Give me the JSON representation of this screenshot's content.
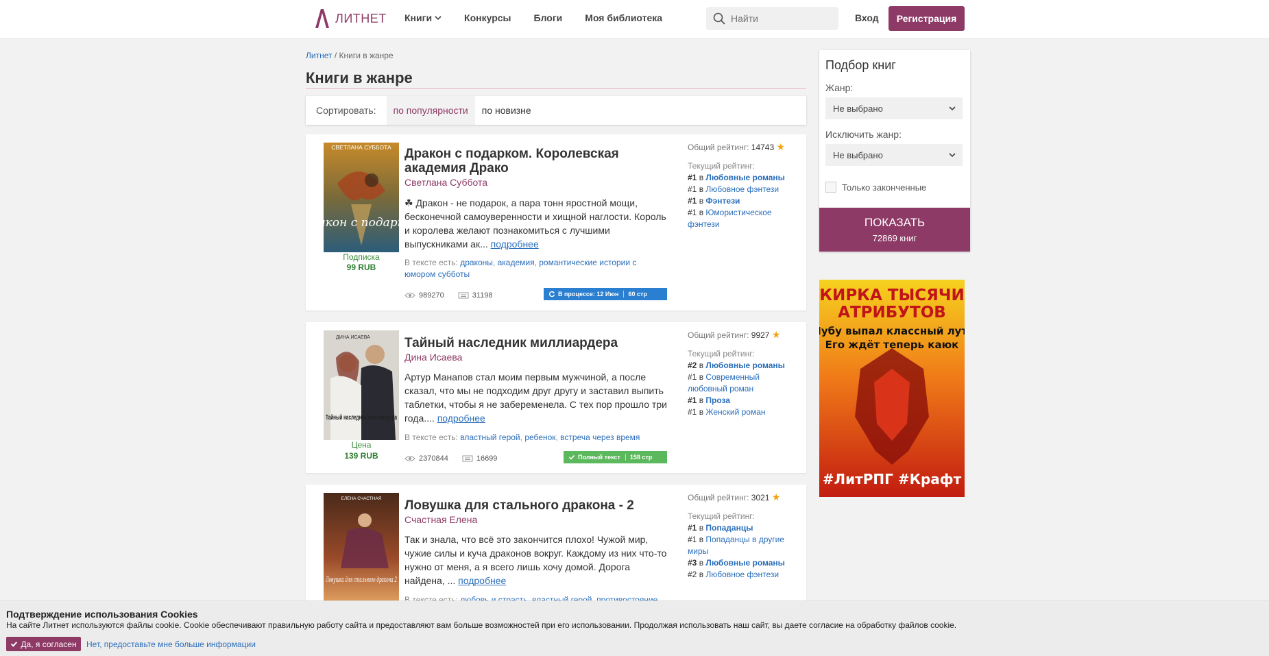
{
  "header": {
    "logo_text": "ЛИТНЕТ",
    "nav": [
      "Книги",
      "Конкурсы",
      "Блоги",
      "Моя библиотека"
    ],
    "search_placeholder": "Найти",
    "login": "Вход",
    "register": "Регистрация"
  },
  "breadcrumb": {
    "home": "Литнет",
    "sep": " / ",
    "current": "Книги в жанре"
  },
  "page_title": "Книги в жанре",
  "sort": {
    "label": "Сортировать:",
    "active": "по популярности",
    "other": "по новизне"
  },
  "books": [
    {
      "title": "Дракон с подарком. Королевская академия Драко",
      "author": "Светлана Суббота",
      "cover_author": "СВЕТЛАНА СУББОТА",
      "cover_title": "Дракон с подарком",
      "desc": "☘ Дракон - не подарок, а пара тонн яростной мощи, бесконечной самоуверенности и хищной наглости. Король и королева желают познакомиться с лучшими выпускниками ак...",
      "more": "подробнее",
      "tags_label": "В тексте есть:",
      "tags": [
        "драконы",
        "академия",
        "романтические истории с юмором субботы"
      ],
      "price_type": "Подписка",
      "price": "99 RUB",
      "views": "989270",
      "comments": "31198",
      "status": "В процессе: 12 Июн",
      "pages": "60 стр",
      "total_label": "Общий рейтинг:",
      "total": "14743",
      "current_label": "Текущий рейтинг:",
      "ranks": [
        {
          "pos": "#1",
          "in": " в ",
          "genre": "Любовные романы",
          "bold": true
        },
        {
          "pos": "#1",
          "in": " в ",
          "genre": "Любовное фэнтези",
          "bold": false
        },
        {
          "pos": "#1",
          "in": " в ",
          "genre": "Фэнтези",
          "bold": true
        },
        {
          "pos": "#1",
          "in": " в ",
          "genre": "Юмористическое фэнтези",
          "bold": false
        }
      ]
    },
    {
      "title": "Тайный наследник миллиардера",
      "author": "Дина Исаева",
      "cover_author": "ДИНА ИСАЕВА",
      "cover_title": "Тайный наследник миллиардера",
      "desc": "Артур Манапов стал моим первым мужчиной, а после сказал, что мы не подходим друг другу и заставил выпить таблетки, чтобы я не забеременела. С тех пор прошло три года.... ",
      "more": "подробнее",
      "tags_label": "В тексте есть:",
      "tags": [
        "властный герой",
        "ребенок",
        "встреча через время"
      ],
      "price_type": "Цена",
      "price": "139 RUB",
      "views": "2370844",
      "comments": "16699",
      "status": "Полный текст",
      "pages": "158 стр",
      "total_label": "Общий рейтинг:",
      "total": "9927",
      "current_label": "Текущий рейтинг:",
      "ranks": [
        {
          "pos": "#2",
          "in": " в ",
          "genre": "Любовные романы",
          "bold": true
        },
        {
          "pos": "#1",
          "in": " в ",
          "genre": "Современный любовный роман",
          "bold": false
        },
        {
          "pos": "#1",
          "in": " в ",
          "genre": "Проза",
          "bold": true
        },
        {
          "pos": "#1",
          "in": " в ",
          "genre": "Женский роман",
          "bold": false
        }
      ]
    },
    {
      "title": "Ловушка для стального дракона - 2",
      "author": "Счастная Елена",
      "cover_author": "ЕЛЕНА СЧАСТНАЯ",
      "cover_title": "Ловушка для стального дракона 2",
      "desc": "Так и знала, что всё это закончится плохо! Чужой мир, чужие силы и куча драконов вокруг. Каждому из них что-то нужно от меня, а я всего лишь хочу домой. Дорога найдена, ... ",
      "more": "подробнее",
      "tags_label": "В тексте есть:",
      "tags": [
        "любовь и страсть",
        "властный герой",
        "противостояние"
      ],
      "total_label": "Общий рейтинг:",
      "total": "3021",
      "current_label": "Текущий рейтинг:",
      "ranks": [
        {
          "pos": "#1",
          "in": " в ",
          "genre": "Попаданцы",
          "bold": true
        },
        {
          "pos": "#1",
          "in": " в ",
          "genre": "Попаданцы в другие миры",
          "bold": false
        },
        {
          "pos": "#3",
          "in": " в ",
          "genre": "Любовные романы",
          "bold": true
        },
        {
          "pos": "#2",
          "in": " в ",
          "genre": "Любовное фэнтези",
          "bold": false
        }
      ]
    }
  ],
  "filter": {
    "title": "Подбор книг",
    "genre_label": "Жанр:",
    "genre_value": "Не выбрано",
    "exclude_label": "Исключить жанр:",
    "exclude_value": "Не выбрано",
    "finished_label": "Только законченные",
    "show": "ПОКАЗАТЬ",
    "count": "72869 книг"
  },
  "ad": {
    "line1": "КИРКА ТЫСЯЧИ",
    "line2": "АТРИБУТОВ",
    "line3": "Нубу выпал классный лут.",
    "line4": "Его ждёт теперь каюк",
    "tags": "#ЛитРПГ #Крафт"
  },
  "cookie": {
    "title": "Подтверждение использования Cookies",
    "text": "На сайте Литнет используются файлы cookie. Cookie обеспечивают правильную работу сайта и предоставляют вам больше возможностей при его использовании. Продолжая использовать наш сайт, вы даете согласие на обработку файлов cookie.",
    "agree": "Да, я согласен",
    "more": "Нет, предоставьте мне больше информации"
  },
  "colors": {
    "brand": "#8e3a66",
    "link": "#2a6ebb",
    "in_progress": "#2a7fd1",
    "complete": "#5cb85c",
    "star": "#f0a30a"
  }
}
